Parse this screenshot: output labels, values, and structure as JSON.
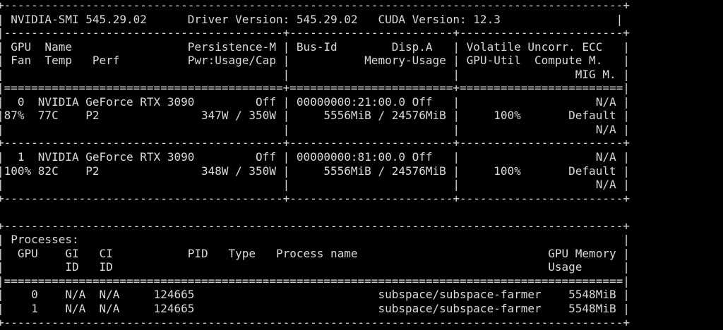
{
  "colors": {
    "background": "#000000",
    "text": "#d9d9d9"
  },
  "header": {
    "smi": "NVIDIA-SMI 545.29.02",
    "driver": "Driver Version: 545.29.02",
    "cuda": "CUDA Version: 12.3"
  },
  "gpu_table": {
    "col1_head": [
      "GPU  Name",
      "Fan  Temp   Perf"
    ],
    "col1_head_right": [
      "Persistence-M",
      "Pwr:Usage/Cap"
    ],
    "col2_head": [
      "Bus-Id        Disp.A",
      "Memory-Usage",
      ""
    ],
    "col3_head": [
      "Volatile Uncorr. ECC",
      "GPU-Util  Compute M.",
      "MIG M."
    ],
    "gpus": [
      {
        "index": "0",
        "name": "NVIDIA GeForce RTX 3090",
        "persistence": "Off",
        "fan": "87%",
        "temp": "77C",
        "perf": "P2",
        "power": "347W / 350W",
        "bus_id": "00000000:21:00.0",
        "disp": "Off",
        "memory": "5556MiB / 24576MiB",
        "ecc": "N/A",
        "util": "100%",
        "compute": "Default",
        "mig": "N/A"
      },
      {
        "index": "1",
        "name": "NVIDIA GeForce RTX 3090",
        "persistence": "Off",
        "fan": "100%",
        "temp": "82C",
        "perf": "P2",
        "power": "348W / 350W",
        "bus_id": "00000000:81:00.0",
        "disp": "Off",
        "memory": "5556MiB / 24576MiB",
        "ecc": "N/A",
        "util": "100%",
        "compute": "Default",
        "mig": "N/A"
      }
    ]
  },
  "processes": {
    "title": "Processes:",
    "head1": [
      "GPU",
      "GI",
      "CI",
      "PID",
      "Type",
      "Process name",
      "GPU Memory"
    ],
    "head2": [
      "ID",
      "ID",
      "Usage"
    ],
    "rows": [
      {
        "gpu": "0",
        "gi": "N/A",
        "ci": "N/A",
        "pid": "124665",
        "type": "",
        "name": "subspace/subspace-farmer",
        "mem": "5548MiB"
      },
      {
        "gpu": "1",
        "gi": "N/A",
        "ci": "N/A",
        "pid": "124665",
        "type": "",
        "name": "subspace/subspace-farmer",
        "mem": "5548MiB"
      }
    ]
  }
}
